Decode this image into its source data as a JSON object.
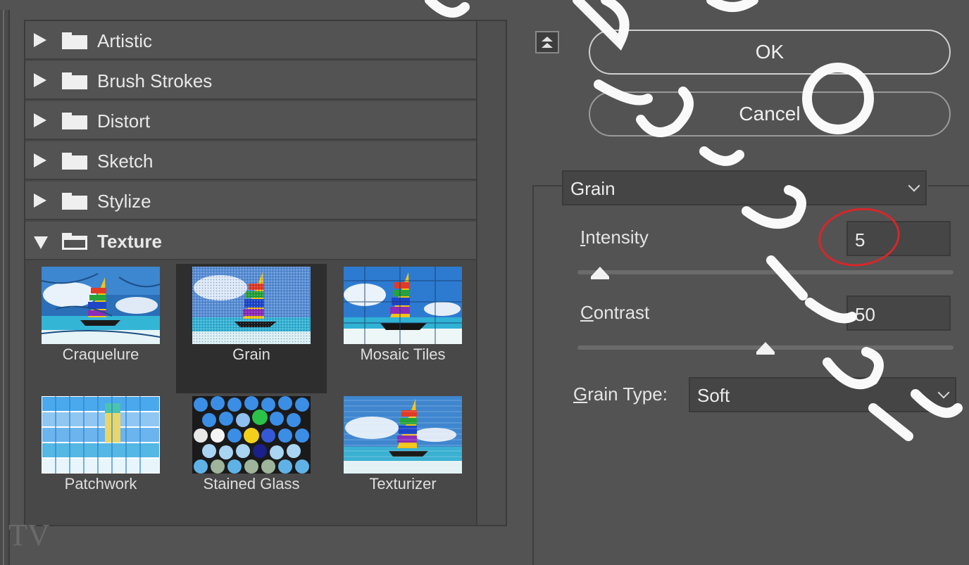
{
  "browser": {
    "categories": [
      {
        "label": "Artistic",
        "expanded": false
      },
      {
        "label": "Brush Strokes",
        "expanded": false
      },
      {
        "label": "Distort",
        "expanded": false
      },
      {
        "label": "Sketch",
        "expanded": false
      },
      {
        "label": "Stylize",
        "expanded": false
      },
      {
        "label": "Texture",
        "expanded": true
      }
    ],
    "filters": [
      {
        "label": "Craquelure",
        "selected": false
      },
      {
        "label": "Grain",
        "selected": true
      },
      {
        "label": "Mosaic Tiles",
        "selected": false
      },
      {
        "label": "Patchwork",
        "selected": false
      },
      {
        "label": "Stained Glass",
        "selected": false
      },
      {
        "label": "Texturizer",
        "selected": false
      }
    ]
  },
  "buttons": {
    "ok_label": "OK",
    "cancel_label": "Cancel"
  },
  "filter_select": {
    "value": "Grain"
  },
  "params": {
    "intensity_label_first": "I",
    "intensity_label_rest": "ntensity",
    "intensity_value": "5",
    "intensity_level": 0.06,
    "contrast_label_first": "C",
    "contrast_label_rest": "ontrast",
    "contrast_value": "50",
    "contrast_level": 0.5,
    "grain_type_label_first": "G",
    "grain_type_label_rest": "rain Type:",
    "grain_type_value": "Soft"
  },
  "colors": {
    "panel_bg": "#535353",
    "highlight": "#d8262a"
  }
}
